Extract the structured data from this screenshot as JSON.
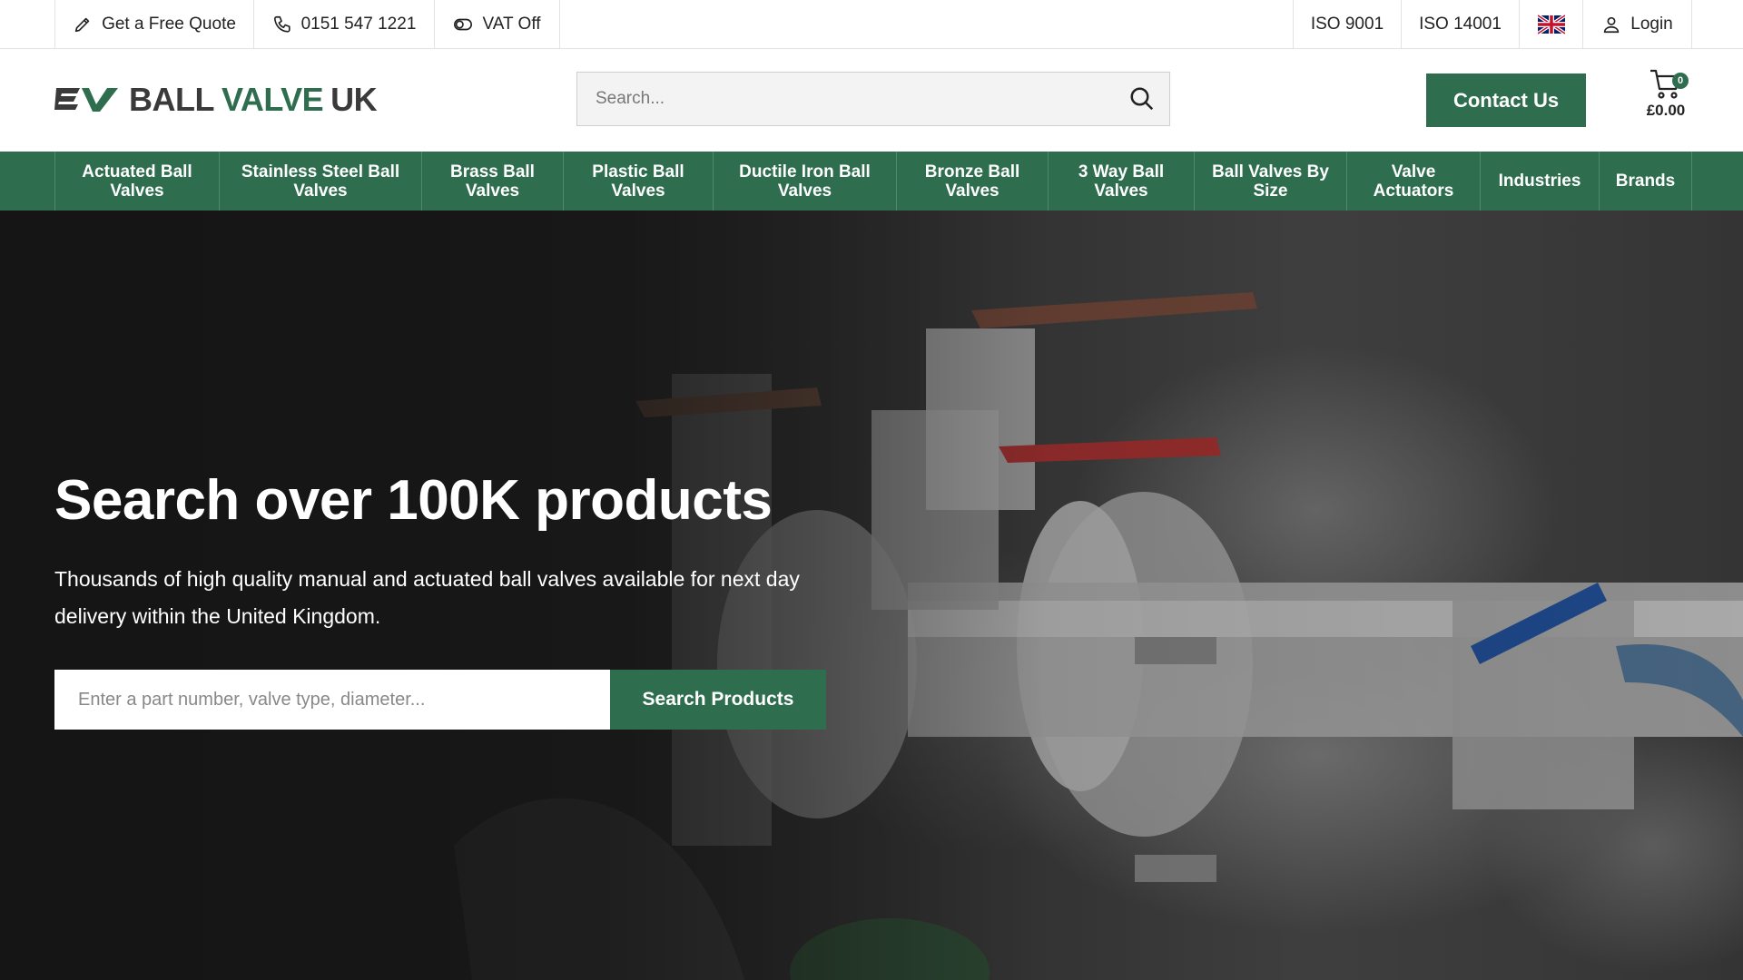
{
  "topbar": {
    "quote_label": "Get a Free Quote",
    "phone_label": "0151 547 1221",
    "vat_label": "VAT Off",
    "iso1_label": "ISO 9001",
    "iso2_label": "ISO 14001",
    "login_label": "Login"
  },
  "header": {
    "logo_word1": "BALL",
    "logo_word2": "VALVE",
    "logo_word3": "UK",
    "search_placeholder": "Search...",
    "contact_label": "Contact Us",
    "cart_count": "0",
    "cart_total": "£0.00"
  },
  "nav": {
    "items": [
      {
        "line1": "Actuated Ball",
        "line2": "Valves"
      },
      {
        "line1": "Stainless Steel Ball",
        "line2": "Valves"
      },
      {
        "line1": "Brass Ball",
        "line2": "Valves"
      },
      {
        "line1": "Plastic Ball",
        "line2": "Valves"
      },
      {
        "line1": "Ductile Iron Ball",
        "line2": "Valves"
      },
      {
        "line1": "Bronze Ball",
        "line2": "Valves"
      },
      {
        "line1": "3 Way Ball",
        "line2": "Valves"
      },
      {
        "line1": "Ball Valves By",
        "line2": "Size"
      },
      {
        "line1": "Valve",
        "line2": "Actuators"
      },
      {
        "line1": "Industries",
        "line2": ""
      },
      {
        "line1": "Brands",
        "line2": ""
      }
    ]
  },
  "hero": {
    "title": "Search over 100K products",
    "description": "Thousands of high quality manual and actuated ball valves available for next day delivery within the United Kingdom.",
    "search_placeholder": "Enter a part number, valve type, diameter...",
    "search_button": "Search Products"
  },
  "colors": {
    "brand_green": "#2e6d4e",
    "text_dark": "#222222"
  },
  "icons": {
    "quote": "pencil-icon",
    "phone": "phone-icon",
    "vat": "toggle-icon",
    "flag": "uk-flag-icon",
    "login": "user-icon",
    "search": "search-icon",
    "cart": "cart-icon"
  }
}
